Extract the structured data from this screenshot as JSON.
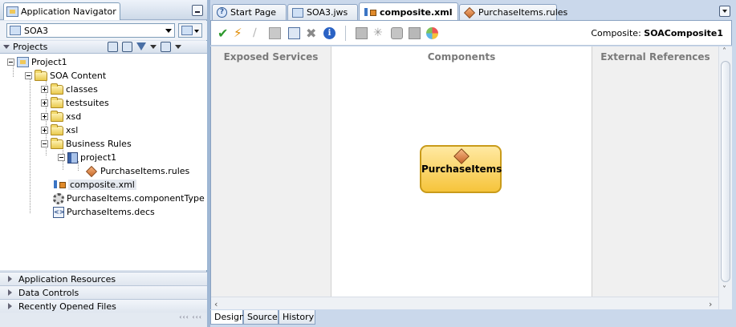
{
  "navigator": {
    "title": "Application Navigator",
    "application": "SOA3",
    "projects_label": "Projects",
    "tree": {
      "project": "Project1",
      "soa_content": "SOA Content",
      "classes": "classes",
      "testsuites": "testsuites",
      "xsd": "xsd",
      "xsl": "xsl",
      "business_rules": "Business Rules",
      "rules_project": "project1",
      "rules_file": "PurchaseItems.rules",
      "composite": "composite.xml",
      "component_type": "PurchaseItems.componentType",
      "decs": "PurchaseItems.decs"
    },
    "accordion": [
      "Application Resources",
      "Data Controls",
      "Recently Opened Files"
    ]
  },
  "editor": {
    "tabs": [
      {
        "label": "Start Page",
        "icon": "help-icon"
      },
      {
        "label": "SOA3.jws",
        "icon": "workspace-icon"
      },
      {
        "label": "composite.xml",
        "icon": "composite-icon",
        "active": true
      },
      {
        "label": "PurchaseItems.rules",
        "icon": "business-rule-icon"
      }
    ],
    "toolbar": {
      "composite_label": "Composite:",
      "composite_name": "SOAComposite1"
    },
    "lanes": {
      "exposed": "Exposed Services",
      "components": "Components",
      "external": "External References"
    },
    "component": {
      "name": "PurchaseItems",
      "icon": "business-rule-icon"
    },
    "bottom_tabs": [
      "Design",
      "Source",
      "History"
    ]
  }
}
